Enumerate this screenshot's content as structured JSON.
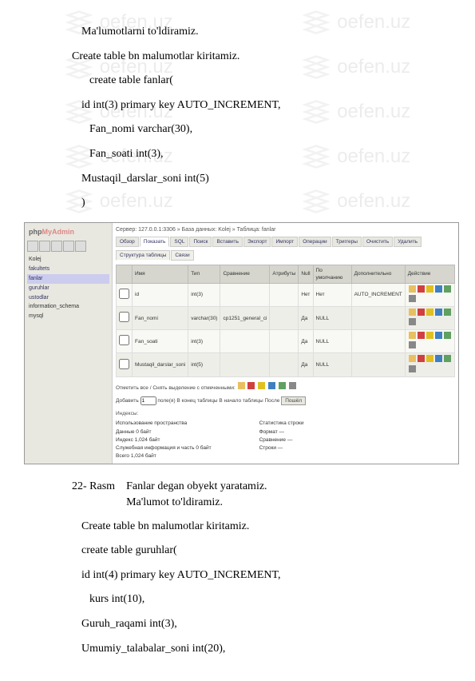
{
  "doc": {
    "p1": "Ma'lumotlarni to'ldiramiz.",
    "p2": "Create table bn malumotlar kiritamiz.",
    "p3": "create table fanlar(",
    "p4": "id int(3) primary key AUTO_INCREMENT,",
    "p5": "Fan_nomi varchar(30),",
    "p6": "Fan_soati int(3),",
    "p7": "Mustaqil_darslar_soni int(5)",
    "p8": ")",
    "cap_label": "22-  Rasm",
    "cap_text1": "Fanlar degan obyekt yaratamiz.",
    "cap_text2": "Ma'lumot to'ldiramiz.",
    "p9": "Create table bn malumotlar kiritamiz.",
    "p10": "create table guruhlar(",
    "p11": "id int(4) primary key AUTO_INCREMENT,",
    "p12": "kurs int(10),",
    "p13": "Guruh_raqami int(3),",
    "p14": "Umumiy_talabalar_soni int(20),"
  },
  "watermark": "oefen.uz",
  "pma": {
    "logo": "phpMyAdmin",
    "server": "Сервер: 127.0.0.1:3306 » База данных: Kolej » Таблица: fanlar",
    "tabs": [
      "Обзор",
      "Показать",
      "SQL",
      "Поиск",
      "Вставить",
      "Экспорт",
      "Импорт",
      "Операции",
      "Триггеры",
      "Очистить",
      "Удалить"
    ],
    "tabs2": [
      "Структура таблицы",
      "Связи"
    ],
    "tree": {
      "root": "Kolej",
      "items": [
        "fakultets",
        "fanlar",
        "guruhlar",
        "ustodlar"
      ],
      "db2": "information_schema",
      "db3": "mysql"
    },
    "cols": {
      "h": [
        "",
        "Имя",
        "Тип",
        "Сравнение",
        "Атрибуты",
        "Null",
        "По умолчанию",
        "Дополнительно",
        "Действие"
      ],
      "rows": [
        {
          "chk": "",
          "name": "id",
          "type": "int(3)",
          "coll": "",
          "attr": "",
          "null": "Нет",
          "def": "Нет",
          "extra": "AUTO_INCREMENT"
        },
        {
          "chk": "",
          "name": "Fan_nomi",
          "type": "varchar(30)",
          "coll": "cp1251_general_ci",
          "attr": "",
          "null": "Да",
          "def": "NULL",
          "extra": ""
        },
        {
          "chk": "",
          "name": "Fan_soati",
          "type": "int(3)",
          "coll": "",
          "attr": "",
          "null": "Да",
          "def": "NULL",
          "extra": ""
        },
        {
          "chk": "",
          "name": "Mustaqil_darslar_soni",
          "type": "int(5)",
          "coll": "",
          "attr": "",
          "null": "Да",
          "def": "NULL",
          "extra": ""
        }
      ]
    },
    "checkall": "Отметить все / Снять выделение с отмеченными:",
    "addcol1": "Добавить",
    "addcol_n": "1",
    "addcol2": "поле(я)   В конец таблицы   В начало таблицы   После",
    "addcol_btn": "Пошёл",
    "info_h": "Индексы:",
    "info": {
      "left_h": "Использование пространства",
      "left": [
        [
          "Данные",
          "0  байт"
        ],
        [
          "Индекс",
          "1,024  байт"
        ],
        [
          "Служебная информация и часть",
          "0  байт"
        ],
        [
          "Всего",
          "1,024  байт"
        ]
      ],
      "right_h": "Статистика строки",
      "right": [
        [
          "Формат",
          "—"
        ],
        [
          "Сравнение",
          "—"
        ],
        [
          "Строки",
          "—"
        ]
      ]
    }
  }
}
